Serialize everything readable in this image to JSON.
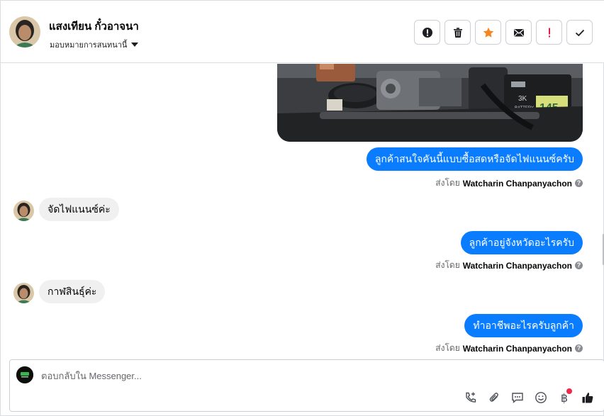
{
  "header": {
    "contact_name": "แสงเทียน กั๋วอาจนา",
    "assign_label": "มอบหมายการสนทนานี้",
    "actions": [
      {
        "name": "spam-button",
        "icon": "alert-circle-icon"
      },
      {
        "name": "delete-button",
        "icon": "trash-icon"
      },
      {
        "name": "star-button",
        "icon": "star-icon",
        "color": "#f5861f"
      },
      {
        "name": "mark-unread-button",
        "icon": "envelope-icon"
      },
      {
        "name": "follow-up-button",
        "icon": "exclamation-icon",
        "color": "#e41e3f"
      },
      {
        "name": "done-button",
        "icon": "checkmark-icon"
      }
    ]
  },
  "conversation": {
    "attachment": {
      "kind": "image",
      "subject": "engine-bay-photo"
    },
    "messages": [
      {
        "direction": "out",
        "text": "ลูกค้าสนใจคันนี้แบบซื้อสดหรือจัดไฟแนนซ์ครับ",
        "sent_by_prefix": "ส่งโดย",
        "sender": "Watcharin Chanpanyachon"
      },
      {
        "direction": "in",
        "text": "จัดไฟแนนซ์ค่ะ"
      },
      {
        "direction": "out",
        "text": "ลูกค้าอยู่จังหวัดอะไรครับ",
        "sent_by_prefix": "ส่งโดย",
        "sender": "Watcharin Chanpanyachon"
      },
      {
        "direction": "in",
        "text": "กาฬสินธุ์ค่ะ"
      },
      {
        "direction": "out",
        "text": "ทำอาชีพอะไรครับลูกค้า",
        "sent_by_prefix": "ส่งโดย",
        "sender": "Watcharin Chanpanyachon"
      }
    ]
  },
  "composer": {
    "placeholder": "ตอบกลับใน Messenger...",
    "tools": [
      "phone-plus-icon",
      "paperclip-icon",
      "message-icon",
      "smile-icon",
      "baht-icon",
      "thumbs-up-icon"
    ]
  },
  "colors": {
    "outgoing_bubble": "#0a7cff",
    "incoming_bubble": "#f0f0f0",
    "star": "#f5861f",
    "alert": "#e41e3f"
  }
}
